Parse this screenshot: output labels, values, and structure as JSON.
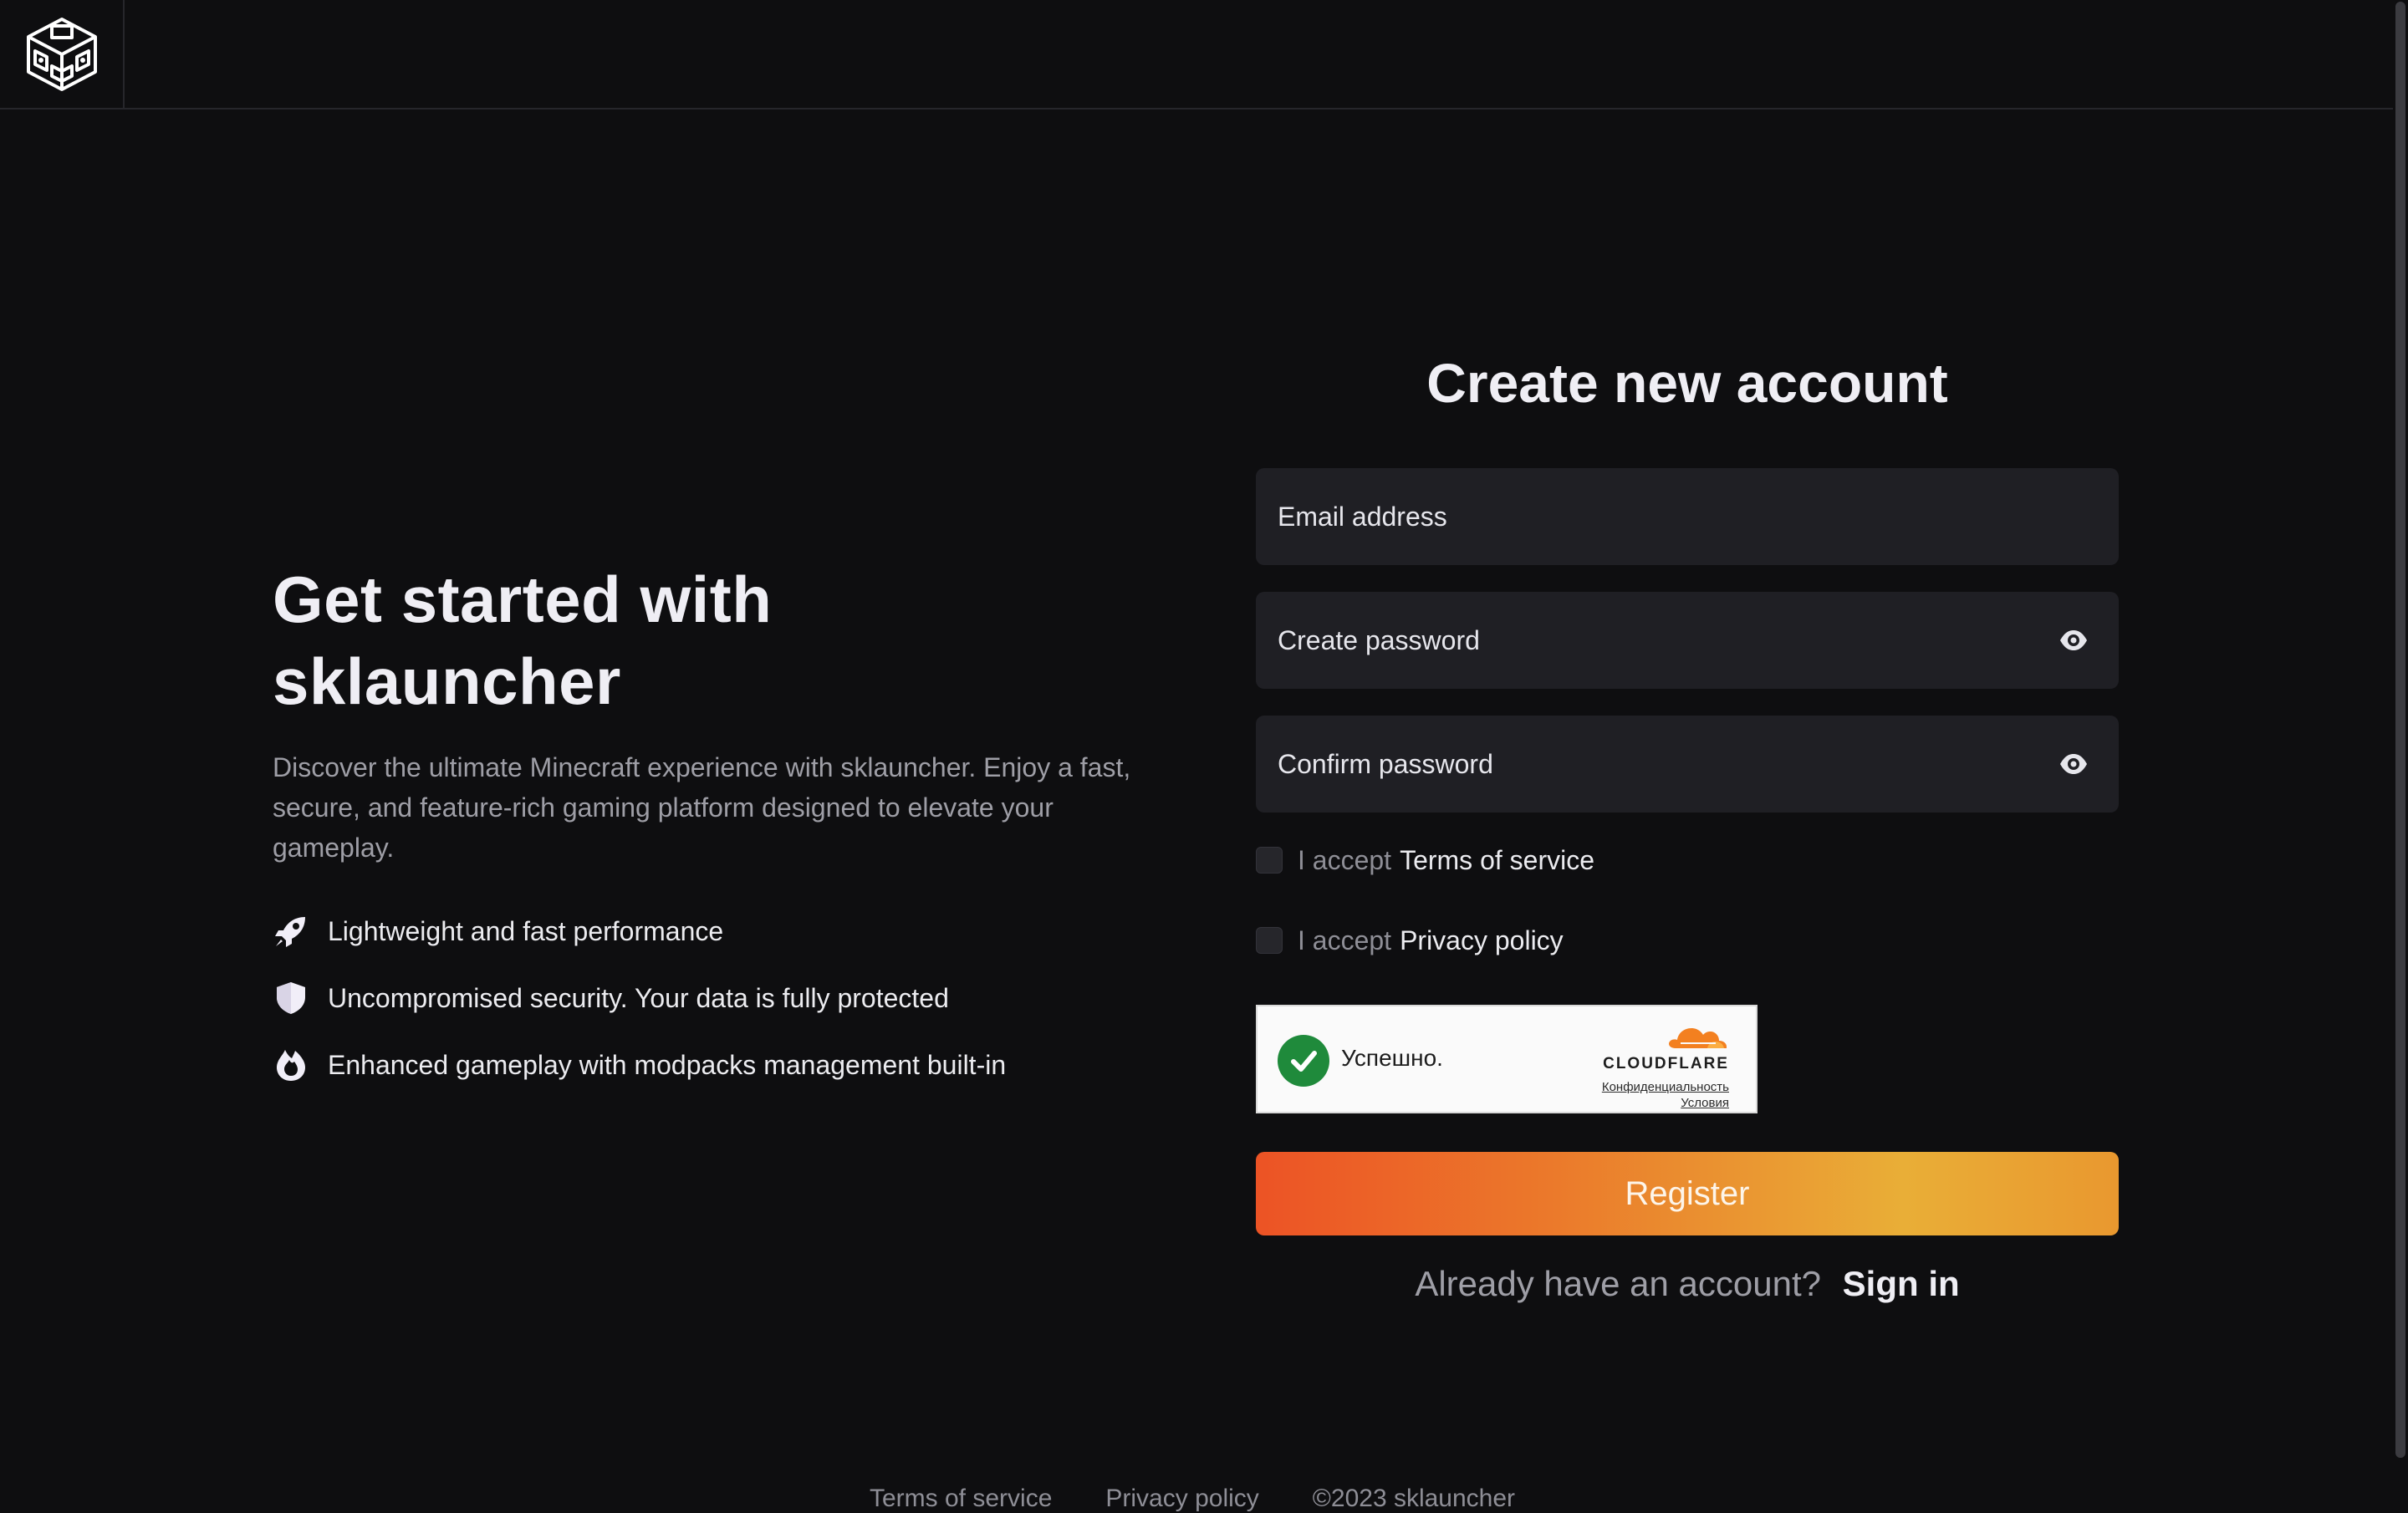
{
  "header": {
    "logo_name": "cube-logo-icon"
  },
  "hero": {
    "title": "Get started with sklauncher",
    "description": "Discover the ultimate Minecraft experience with sklauncher. Enjoy a fast, secure, and feature-rich gaming platform designed to elevate your gameplay.",
    "features": [
      {
        "icon": "rocket-icon",
        "text": "Lightweight and fast performance"
      },
      {
        "icon": "shield-icon",
        "text": "Uncompromised security. Your data is fully protected"
      },
      {
        "icon": "flame-icon",
        "text": "Enhanced gameplay with modpacks management built-in"
      }
    ]
  },
  "form": {
    "title": "Create new account",
    "email_placeholder": "Email address",
    "password_placeholder": "Create password",
    "confirm_placeholder": "Confirm password",
    "terms_prefix": "I accept",
    "terms_link": "Terms of service",
    "privacy_prefix": "I accept",
    "privacy_link": "Privacy policy",
    "captcha": {
      "status": "Успешно.",
      "brand": "CLOUDFLARE",
      "privacy": "Конфиденциальность",
      "terms": "Условия"
    },
    "register_label": "Register",
    "signin_prompt": "Already have an account?",
    "signin_link": "Sign in"
  },
  "footer": {
    "terms": "Terms of service",
    "privacy": "Privacy policy",
    "copyright": "©2023 sklauncher"
  },
  "colors": {
    "background": "#0e0e10",
    "field_bg": "#1f1f24",
    "accent_start": "#ec5325",
    "accent_end": "#e9ae37"
  }
}
